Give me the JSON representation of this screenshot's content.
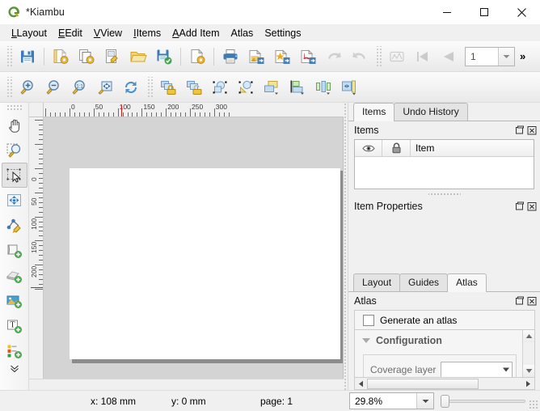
{
  "window": {
    "title": "*Kiambu",
    "logo_icon": "qgis-logo-icon",
    "minimize_label": "—",
    "maximize_label": "□",
    "close_label": "✕"
  },
  "menubar": {
    "items": [
      {
        "label": "Layout",
        "mnemonic": "L"
      },
      {
        "label": "Edit",
        "mnemonic": "E"
      },
      {
        "label": "View",
        "mnemonic": "V"
      },
      {
        "label": "Items",
        "mnemonic": "I"
      },
      {
        "label": "Add Item",
        "mnemonic": "A"
      },
      {
        "label": "Atlas",
        "mnemonic": ""
      },
      {
        "label": "Settings",
        "mnemonic": ""
      }
    ]
  },
  "toolbar_main": {
    "buttons": [
      {
        "name": "save-project-button",
        "icon": "floppy-disk-icon",
        "tooltip": "Save Project"
      },
      {
        "name": "new-layout-button",
        "icon": "new-layout-icon",
        "tooltip": "New Layout"
      },
      {
        "name": "duplicate-layout-button",
        "icon": "duplicate-layout-icon",
        "tooltip": "Duplicate Layout"
      },
      {
        "name": "layout-manager-button",
        "icon": "layout-manager-icon",
        "tooltip": "Layout Manager"
      },
      {
        "name": "open-template-button",
        "icon": "folder-open-icon",
        "tooltip": "Add Items from Template"
      },
      {
        "name": "save-template-button",
        "icon": "save-template-icon",
        "tooltip": "Save as Template"
      },
      {
        "name": "layout-properties-button",
        "icon": "page-properties-icon",
        "tooltip": "Layout Properties"
      },
      {
        "name": "print-button",
        "icon": "printer-icon",
        "tooltip": "Print Layout"
      },
      {
        "name": "export-image-button",
        "icon": "export-image-icon",
        "tooltip": "Export as Image"
      },
      {
        "name": "export-svg-button",
        "icon": "export-svg-icon",
        "tooltip": "Export as SVG"
      },
      {
        "name": "export-pdf-button",
        "icon": "export-pdf-icon",
        "tooltip": "Export as PDF"
      },
      {
        "name": "undo-button",
        "icon": "undo-arrow-icon",
        "tooltip": "Undo",
        "disabled": true
      },
      {
        "name": "redo-button",
        "icon": "redo-arrow-icon",
        "tooltip": "Redo",
        "disabled": true
      },
      {
        "name": "atlas-settings-button",
        "icon": "atlas-settings-icon",
        "tooltip": "Atlas Settings",
        "disabled": true
      },
      {
        "name": "atlas-first-feature-button",
        "icon": "first-feature-icon",
        "tooltip": "First Feature",
        "disabled": true
      },
      {
        "name": "atlas-previous-feature-button",
        "icon": "previous-feature-icon",
        "tooltip": "Previous Feature",
        "disabled": true
      }
    ],
    "page_spinner": {
      "value": "1",
      "name": "atlas-feature-spinner"
    },
    "overflow_label": "»"
  },
  "toolbar_tools": {
    "buttons": [
      {
        "name": "zoom-in-button",
        "icon": "zoom-in-icon"
      },
      {
        "name": "zoom-out-button",
        "icon": "zoom-out-icon"
      },
      {
        "name": "zoom-100-button",
        "icon": "zoom-actual-icon"
      },
      {
        "name": "zoom-full-button",
        "icon": "zoom-full-icon"
      },
      {
        "name": "refresh-view-button",
        "icon": "refresh-icon"
      },
      {
        "name": "lock-items-button",
        "icon": "lock-items-icon"
      },
      {
        "name": "unlock-items-button",
        "icon": "unlock-items-icon"
      },
      {
        "name": "group-items-button",
        "icon": "group-items-icon"
      },
      {
        "name": "ungroup-items-button",
        "icon": "ungroup-items-icon"
      },
      {
        "name": "raise-items-button",
        "icon": "raise-items-icon"
      },
      {
        "name": "align-items-button",
        "icon": "align-items-icon"
      },
      {
        "name": "distribute-items-button",
        "icon": "distribute-items-icon"
      },
      {
        "name": "resize-items-button",
        "icon": "resize-items-icon"
      }
    ]
  },
  "left_toolbar": {
    "buttons": [
      {
        "name": "pan-layout-tool",
        "icon": "pan-hand-icon",
        "active": false
      },
      {
        "name": "zoom-tool",
        "icon": "magnifier-marquee-icon",
        "active": false
      },
      {
        "name": "select-move-item-tool",
        "icon": "select-arrow-icon",
        "active": true
      },
      {
        "name": "move-item-content-tool",
        "icon": "move-content-icon",
        "active": false
      },
      {
        "name": "edit-nodes-tool",
        "icon": "edit-nodes-icon",
        "active": false
      },
      {
        "name": "add-map-button",
        "icon": "add-map-icon",
        "active": false
      },
      {
        "name": "add-3d-map-button",
        "icon": "add-3d-map-icon",
        "active": false
      },
      {
        "name": "add-picture-button",
        "icon": "add-picture-icon",
        "active": false
      },
      {
        "name": "add-label-button",
        "icon": "add-label-icon",
        "active": false
      },
      {
        "name": "add-legend-button",
        "icon": "add-legend-icon",
        "active": false
      }
    ],
    "overflow_label": "»"
  },
  "rulers": {
    "horizontal_labels": [
      "0",
      "50",
      "100",
      "150",
      "200",
      "250",
      "300"
    ],
    "vertical_labels": [
      "0",
      "50",
      "100",
      "150",
      "200"
    ],
    "units": "mm"
  },
  "right_dock": {
    "top_tabs": [
      {
        "label": "Items",
        "selected": true
      },
      {
        "label": "Undo History",
        "selected": false
      }
    ],
    "items_panel": {
      "title": "Items",
      "float_icon": "undock-icon",
      "close_icon": "close-panel-icon",
      "columns": [
        {
          "label": "",
          "icon": "eye-icon"
        },
        {
          "label": "",
          "icon": "lock-icon"
        },
        {
          "label": "Item",
          "icon": ""
        }
      ],
      "rows": []
    },
    "item_properties_panel": {
      "title": "Item Properties",
      "float_icon": "undock-icon",
      "close_icon": "close-panel-icon"
    },
    "bottom_tabs": [
      {
        "label": "Layout",
        "selected": false
      },
      {
        "label": "Guides",
        "selected": false
      },
      {
        "label": "Atlas",
        "selected": true
      }
    ],
    "atlas_panel": {
      "title": "Atlas",
      "float_icon": "undock-icon",
      "close_icon": "close-panel-icon",
      "generate_checkbox_label": "Generate an atlas",
      "generate_checked": false,
      "configuration_group_label": "Configuration",
      "coverage_layer_label": "Coverage layer",
      "coverage_layer_value": ""
    }
  },
  "statusbar": {
    "x_label": "x: 108 mm",
    "y_label": "y: 0 mm",
    "page_label": "page: 1",
    "zoom_value": "29.8%"
  },
  "colors": {
    "window_bg": "#f0f0f0",
    "canvas_bg": "#d4d4d4",
    "page_white": "#ffffff",
    "page_shadow": "#8c8c8c",
    "accent_blue": "#3a7dbe",
    "qgis_green": "#589632",
    "ruler_guide_red": "#d81515"
  }
}
